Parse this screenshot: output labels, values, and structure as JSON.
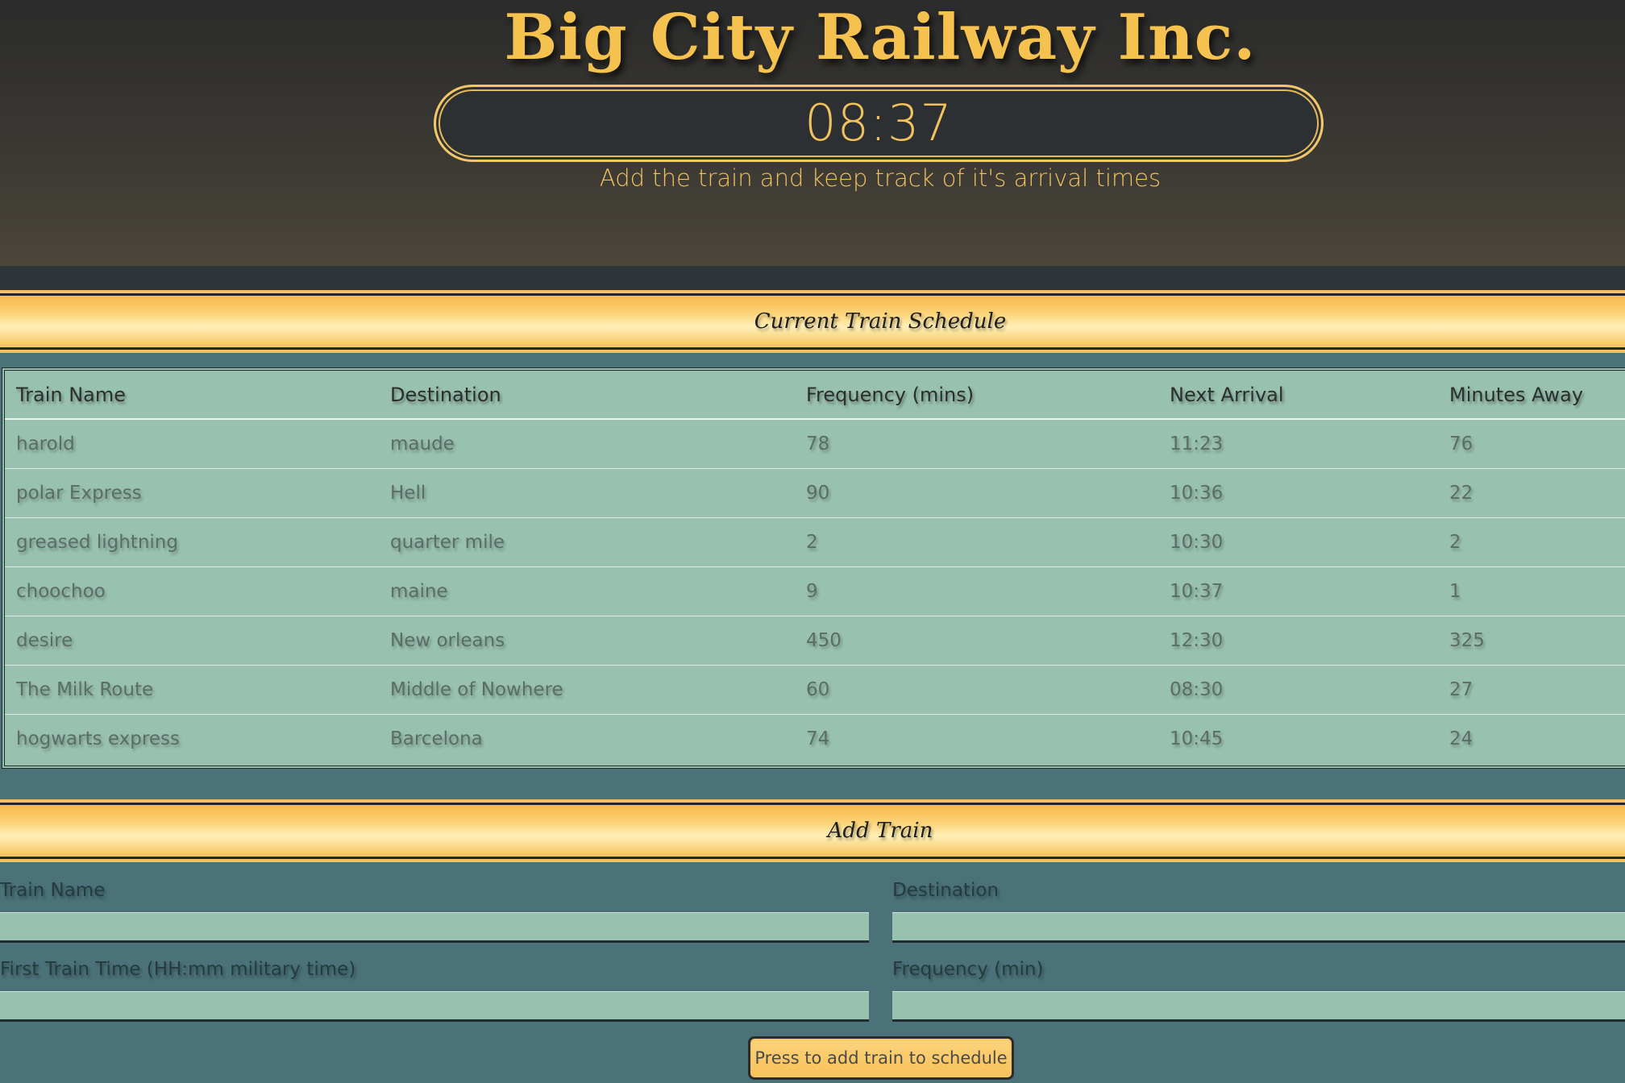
{
  "header": {
    "title": "Big City Railway Inc.",
    "clock": "08:37",
    "subtitle": "Add the train and keep track of it's arrival times"
  },
  "schedule": {
    "section_title": "Current Train Schedule",
    "columns": [
      "Train Name",
      "Destination",
      "Frequency (mins)",
      "Next Arrival",
      "Minutes Away"
    ],
    "rows": [
      [
        "harold",
        "maude",
        "78",
        "11:23",
        "76"
      ],
      [
        "polar Express",
        "Hell",
        "90",
        "10:36",
        "22"
      ],
      [
        "greased lightning",
        "quarter mile",
        "2",
        "10:30",
        "2"
      ],
      [
        "choochoo",
        "maine",
        "9",
        "10:37",
        "1"
      ],
      [
        "desire",
        "New orleans",
        "450",
        "12:30",
        "325"
      ],
      [
        "The Milk Route",
        "Middle of Nowhere",
        "60",
        "08:30",
        "27"
      ],
      [
        "hogwarts express",
        "Barcelona",
        "74",
        "10:45",
        "24"
      ]
    ]
  },
  "form": {
    "section_title": "Add Train",
    "train_name_label": "Train Name",
    "train_name_value": "",
    "destination_label": "Destination",
    "destination_value": "",
    "first_time_label": "First Train Time (HH:mm military time)",
    "first_time_value": "",
    "frequency_label": "Frequency (min)",
    "frequency_value": "",
    "submit_label": "Press to add train to schedule"
  },
  "colors": {
    "gold": "#f1c25e",
    "teal_background": "#4a7278",
    "table_background": "#99c1b0",
    "hero_dark": "#2b2b2b"
  }
}
